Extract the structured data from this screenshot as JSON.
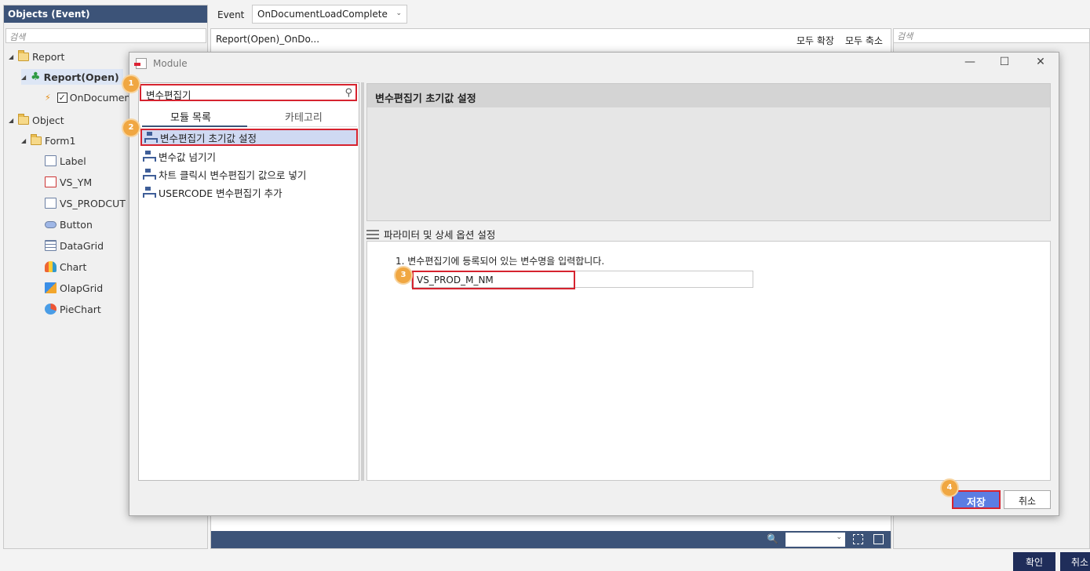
{
  "left_panel": {
    "title": "Objects (Event)",
    "search_placeholder": "검색",
    "tree": {
      "report": "Report",
      "report_open": "Report(Open)",
      "on_document": "OnDocumen",
      "object": "Object",
      "form1": "Form1",
      "items": [
        "Label",
        "VS_YM",
        "VS_PRODCUT",
        "Button",
        "DataGrid",
        "Chart",
        "OlapGrid",
        "PieChart"
      ]
    }
  },
  "toolbar": {
    "event_label": "Event",
    "event_value": "OnDocumentLoadComplete"
  },
  "editor": {
    "breadcrumb": "Report(Open)_OnDo...",
    "expand_all": "모두 확장",
    "collapse_all": "모두 축소"
  },
  "right_panel": {
    "search_placeholder": "검색"
  },
  "footer": {
    "ok": "확인",
    "cancel": "취소"
  },
  "modal": {
    "title": "Module",
    "search_value": "변수편집기",
    "tabs": [
      "모듈 목록",
      "카테고리"
    ],
    "items": [
      "변수편집기 초기값 설정",
      "변수값 넘기기",
      "차트 클릭시 변수편집기 값으로 넣기",
      "USERCODE 변수편집기 추가"
    ],
    "detail_title": "변수편집기 초기값 설정",
    "param_section": "파라미터 및 상세 옵션 설정",
    "param_label": "1. 변수편집기에 등록되어 있는 변수명을 입력합니다.",
    "param_value": "VS_PROD_M_NM",
    "save": "저장",
    "cancel": "취소"
  },
  "badges": [
    "1",
    "2",
    "3",
    "4"
  ],
  "colors": {
    "header_bg": "#3c5378",
    "highlight": "#d6232f",
    "badge": "#f0a742",
    "primary_button": "#5b7de3"
  }
}
